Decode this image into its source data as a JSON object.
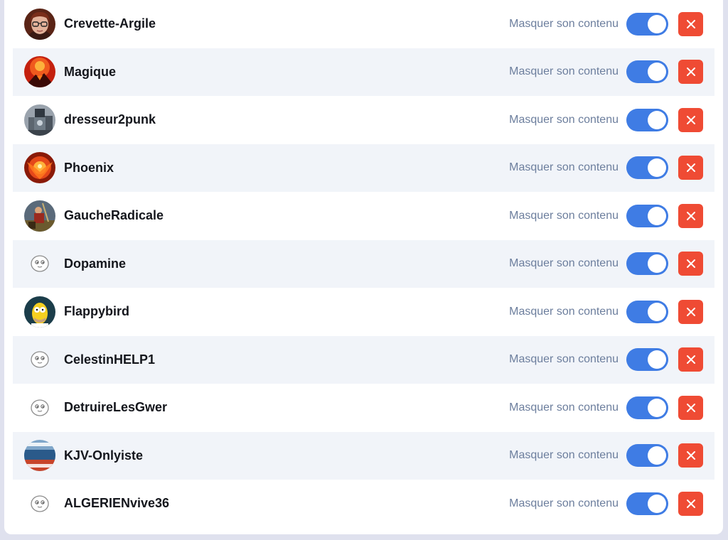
{
  "colors": {
    "accent": "#3f7ce4",
    "danger": "#ef4b34",
    "label": "#6c7e9d",
    "row_alt": "#f1f4f9"
  },
  "blocked_users": [
    {
      "username": "Crevette-Argile",
      "avatar": "girl-glasses-photo",
      "hide_label": "Masquer son contenu",
      "hide_enabled": true
    },
    {
      "username": "Magique",
      "avatar": "volcano-photo",
      "hide_label": "Masquer son contenu",
      "hide_enabled": true
    },
    {
      "username": "dresseur2punk",
      "avatar": "robot-photo",
      "hide_label": "Masquer son contenu",
      "hide_enabled": true
    },
    {
      "username": "Phoenix",
      "avatar": "phoenix-fire-photo",
      "hide_label": "Masquer son contenu",
      "hide_enabled": true
    },
    {
      "username": "GaucheRadicale",
      "avatar": "painting-photo",
      "hide_label": "Masquer son contenu",
      "hide_enabled": true
    },
    {
      "username": "Dopamine",
      "avatar": "default-face-icon",
      "hide_label": "Masquer son contenu",
      "hide_enabled": true
    },
    {
      "username": "Flappybird",
      "avatar": "cartoon-character-photo",
      "hide_label": "Masquer son contenu",
      "hide_enabled": true
    },
    {
      "username": "CelestinHELP1",
      "avatar": "default-face-icon",
      "hide_label": "Masquer son contenu",
      "hide_enabled": true
    },
    {
      "username": "DetruireLesGwer",
      "avatar": "default-face-icon",
      "hide_label": "Masquer son contenu",
      "hide_enabled": true
    },
    {
      "username": "KJV-Onlyiste",
      "avatar": "meme-photo",
      "hide_label": "Masquer son contenu",
      "hide_enabled": true
    },
    {
      "username": "ALGERIENvive36",
      "avatar": "default-face-icon",
      "hide_label": "Masquer son contenu",
      "hide_enabled": true
    }
  ]
}
